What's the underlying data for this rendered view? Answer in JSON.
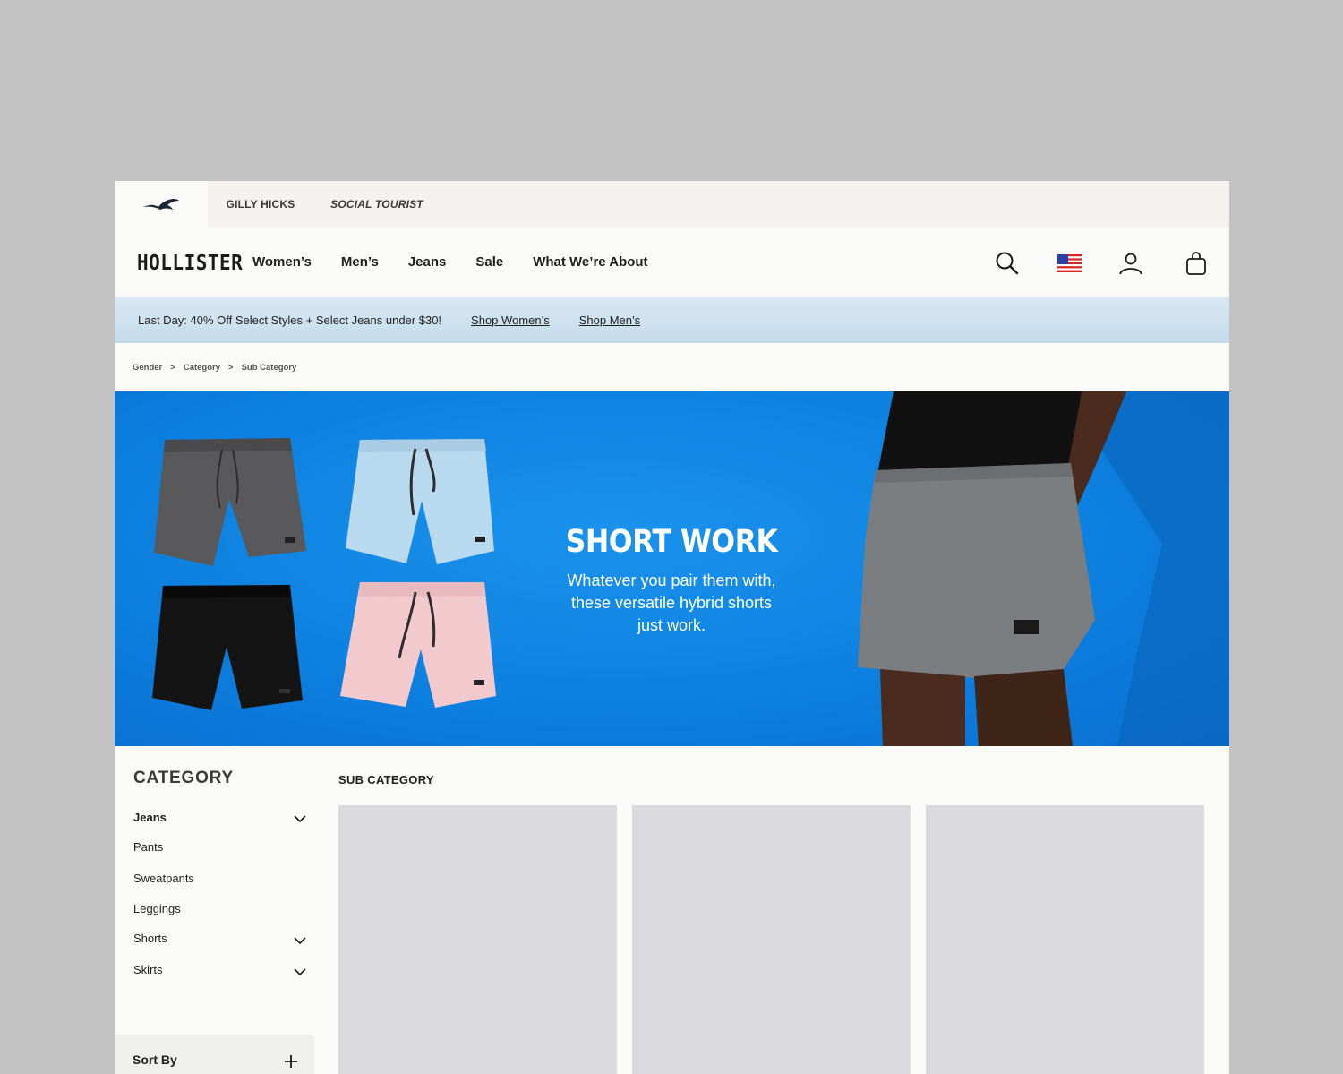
{
  "brand_bar": {
    "tabs": [
      {
        "label": "",
        "icon": "seagull-logo-icon"
      },
      {
        "label": "GILLY HICKS"
      },
      {
        "label": "SOCIAL TOURIST"
      }
    ]
  },
  "header": {
    "logo": "HOLLISTER",
    "nav": [
      "Women’s",
      "Men’s",
      "Jeans",
      "Sale",
      "What We’re About"
    ],
    "icons": [
      "search-icon",
      "us-flag-icon",
      "account-icon",
      "shopping-bag-icon"
    ]
  },
  "promo": {
    "message": "Last Day: 40% Off Select Styles + Select Jeans under $30!",
    "link_women": "Shop Women’s",
    "link_men": "Shop Men’s"
  },
  "breadcrumb": {
    "items": [
      "Gender",
      "Category",
      "Sub Category"
    ],
    "separator": ">"
  },
  "hero": {
    "title": "SHORT WORK",
    "copy": "Whatever you pair them with, these versatile hybrid shorts just work.",
    "background": "#0d80e0",
    "short_colors": [
      "#59595b",
      "#b9d9ee",
      "#141414",
      "#f2c9cc",
      "#7b7e81"
    ]
  },
  "sidebar": {
    "title": "CATEGORY",
    "items": [
      {
        "label": "Jeans",
        "expandable": true,
        "active": true
      },
      {
        "label": "Pants",
        "expandable": false
      },
      {
        "label": "Sweatpants",
        "expandable": false
      },
      {
        "label": "Leggings",
        "expandable": false
      },
      {
        "label": "Shorts",
        "expandable": true
      },
      {
        "label": "Skirts",
        "expandable": true
      }
    ],
    "sort_label": "Sort By"
  },
  "content": {
    "subcategory_title": "SUB CATEGORY"
  }
}
